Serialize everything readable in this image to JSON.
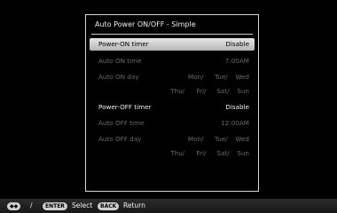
{
  "dialog": {
    "title": "Auto Power ON/OFF - Simple",
    "rows": [
      {
        "label": "Power-ON timer",
        "value": "Disable"
      },
      {
        "label": "Auto ON time",
        "value": "7:00AM"
      },
      {
        "label": "Auto ON day",
        "days_line1": [
          "Mon/",
          "Tue/",
          "Wed"
        ]
      },
      {
        "days_line2": [
          "Thu/",
          "Fri/",
          "Sat/",
          "Sun"
        ]
      },
      {
        "label": "Power-OFF timer",
        "value": "Disable"
      },
      {
        "label": "Auto OFF time",
        "value": "12:00AM"
      },
      {
        "label": "Auto OFF day",
        "days_line1": [
          "Mon/",
          "Tue/",
          "Wed"
        ]
      },
      {
        "days_line2": [
          "Thu/",
          "Fri/",
          "Sat/",
          "Sun"
        ]
      }
    ]
  },
  "footer": {
    "nav_key": "◆◆",
    "separator": "/",
    "enter_key": "ENTER",
    "select_label": "Select",
    "back_key": "BACK",
    "return_label": "Return"
  },
  "colors": {
    "background": "#000000",
    "highlight": "#cfcfcf",
    "disabled_text": "#6a6a6a",
    "enabled_text": "#f2f2f2"
  }
}
